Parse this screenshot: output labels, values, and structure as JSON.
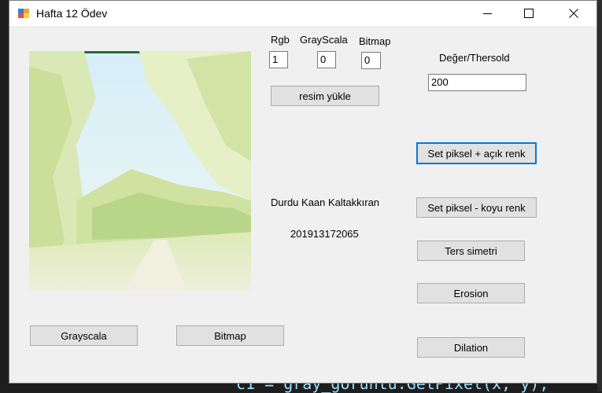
{
  "window": {
    "title": "Hafta 12 Ödev"
  },
  "background": {
    "code_line": "c1 = gray_goruntu.GetPixel(x, y);"
  },
  "labels": {
    "rgb": "Rgb",
    "grayscala": "GrayScala",
    "bitmap": "Bitmap",
    "threshold": "Değer/Thersold",
    "author_name": "Durdu Kaan Kaltakkıran",
    "student_id": "201913172065"
  },
  "inputs": {
    "rgb_value": "1",
    "grayscala_value": "0",
    "bitmap_value": "0",
    "threshold_value": "200"
  },
  "buttons": {
    "load_image": "resim yükle",
    "set_pixel_light": "Set piksel + açık renk",
    "set_pixel_dark": "Set piksel - koyu renk",
    "mirror": "Ters simetri",
    "erosion": "Erosion",
    "dilation": "Dilation",
    "grayscale": "Grayscala",
    "bitmap": "Bitmap"
  },
  "colors": {
    "focus_border": "#0078d7",
    "button_face": "#e1e1e1",
    "window_face": "#f0f0f0"
  }
}
